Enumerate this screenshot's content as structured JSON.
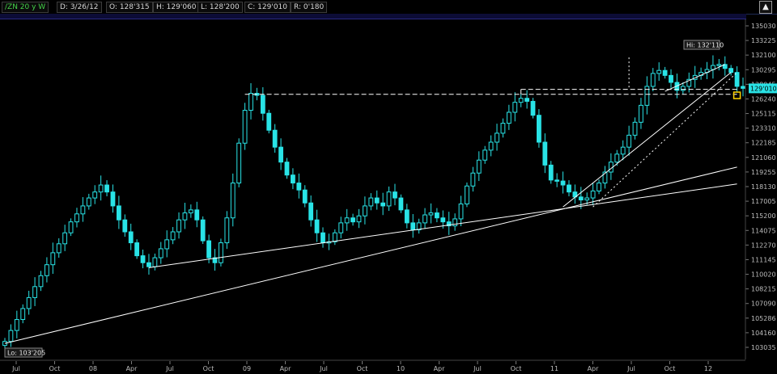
{
  "header": {
    "symbol": "/ZN 20 y W",
    "date": "D: 3/26/12",
    "open": "O: 128'315",
    "high": "H: 129'060",
    "low": "L: 128'200",
    "close": "C: 129'010",
    "range": "R: 0'180"
  },
  "colors": {
    "candle": "#29e3e6",
    "line": "#ffffff",
    "last_box": "#29e3e6",
    "marker": "#ffd400"
  },
  "chart_data": {
    "type": "candlestick",
    "title": "",
    "xlabel": "",
    "ylabel": "",
    "x_ticks": [
      "Jul",
      "Oct",
      "08",
      "Apr",
      "Jul",
      "Oct",
      "09",
      "Apr",
      "Jul",
      "Oct",
      "10",
      "Apr",
      "Jul",
      "Oct",
      "11",
      "Apr",
      "Jul",
      "Oct",
      "12"
    ],
    "y_ticks": [
      "135030",
      "133225",
      "132100",
      "130295",
      "128045",
      "126240",
      "125115",
      "123310",
      "122185",
      "121060",
      "119255",
      "118130",
      "117005",
      "115200",
      "114075",
      "112270",
      "111145",
      "110020",
      "108215",
      "107090",
      "105286",
      "104160",
      "103035"
    ],
    "y_range_decimal": [
      102.6,
      135.6
    ],
    "series_close_decimal": [
      103.6,
      104.7,
      105.8,
      106.9,
      108.0,
      109.1,
      110.2,
      111.3,
      112.5,
      113.4,
      114.5,
      115.6,
      116.4,
      117.2,
      118.0,
      118.6,
      119.3,
      118.6,
      117.2,
      115.8,
      114.6,
      113.5,
      112.2,
      111.5,
      111.1,
      112.0,
      112.9,
      113.8,
      114.6,
      115.8,
      116.5,
      116.8,
      115.8,
      113.7,
      112.0,
      111.5,
      113.5,
      116.0,
      119.5,
      123.5,
      126.8,
      128.5,
      128.3,
      126.5,
      124.8,
      123.1,
      121.6,
      120.3,
      119.5,
      118.8,
      117.5,
      115.8,
      114.5,
      113.5,
      113.6,
      114.5,
      115.5,
      116.0,
      115.6,
      116.2,
      117.2,
      118.0,
      117.5,
      117.2,
      118.6,
      118.0,
      116.8,
      115.5,
      114.8,
      115.5,
      116.3,
      116.5,
      116.0,
      115.6,
      115.2,
      115.9,
      117.4,
      119.2,
      120.5,
      121.8,
      122.8,
      123.6,
      124.5,
      125.5,
      126.6,
      127.6,
      128.0,
      127.7,
      126.3,
      123.6,
      121.3,
      119.8,
      119.7,
      119.3,
      118.6,
      118.1,
      117.8,
      118.0,
      118.7,
      119.5,
      120.6,
      121.6,
      122.4,
      123.1,
      124.3,
      125.6,
      127.3,
      129.2,
      130.5,
      130.8,
      130.3,
      129.6,
      128.8,
      129.2,
      129.9,
      130.3,
      130.6,
      130.9,
      131.3,
      131.4,
      131.0,
      130.6,
      129.2,
      129.0
    ],
    "annotations": {
      "high_label": "Hi: 132'110",
      "low_label": "Lo: 103'205",
      "last_price": "129'010"
    },
    "trendlines": [
      {
        "from": [
          0,
          103.4
        ],
        "to": [
          122,
          121.1
        ]
      },
      {
        "from": [
          24,
          111.0
        ],
        "to": [
          122,
          119.4
        ]
      },
      {
        "from": [
          93,
          117.1
        ],
        "to": [
          121,
          130.6
        ]
      },
      {
        "from": [
          110,
          128.7
        ],
        "to": [
          120,
          131.4
        ]
      }
    ],
    "dashed_levels": [
      {
        "from": [
          40,
          128.4
        ],
        "to": [
          122,
          128.4
        ]
      },
      {
        "from": [
          86,
          128.9
        ],
        "to": [
          122,
          128.9
        ]
      }
    ],
    "dotted_lines": [
      {
        "from": [
          98,
          117.1
        ],
        "to": [
          122,
          130.6
        ]
      },
      {
        "from": [
          104,
          129.1
        ],
        "to": [
          104,
          132.1
        ]
      }
    ],
    "grid": false,
    "legend": "none"
  }
}
